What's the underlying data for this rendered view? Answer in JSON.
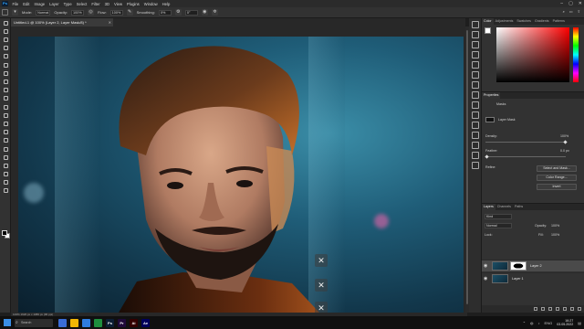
{
  "menubar": {
    "app_icon": "Ps",
    "items": [
      "File",
      "Edit",
      "Image",
      "Layer",
      "Type",
      "Select",
      "Filter",
      "3D",
      "View",
      "Plugins",
      "Window",
      "Help"
    ],
    "window_controls": [
      "minimize-icon",
      "maximize-icon",
      "close-icon"
    ]
  },
  "options": {
    "mode_label": "Mode:",
    "mode_value": "Normal",
    "opacity_label": "Opacity:",
    "opacity_value": "100%",
    "flow_label": "Flow:",
    "flow_value": "100%",
    "smoothing_label": "Smoothing:",
    "smoothing_value": "0%",
    "angle_value": "0°"
  },
  "document": {
    "tab_title": "Untitled-1 @ 100% (Layer 2, Layer Mask/8) *",
    "status": "100%   1920 px x 1080 px (96 ppi)"
  },
  "overlay_buttons": [
    "close-icon",
    "close-icon",
    "close-icon"
  ],
  "panels": {
    "color_tabs": [
      "Color",
      "Adjustments",
      "Swatches",
      "Gradients",
      "Patterns"
    ],
    "properties": {
      "title": "Properties",
      "section": "Masks",
      "mask_label": "Layer Mask",
      "density_label": "Density:",
      "density_value": "100%",
      "feather_label": "Feather:",
      "feather_value": "0.0 px",
      "refine_label": "Refine:",
      "buttons": [
        "Select and Mask...",
        "Color Range...",
        "Invert"
      ]
    },
    "layers": {
      "tabs": [
        "Layers",
        "Channels",
        "Paths"
      ],
      "kind_label": "Kind",
      "blend_mode": "Normal",
      "opacity_label": "Opacity:",
      "opacity_value": "100%",
      "lock_label": "Lock:",
      "fill_label": "Fill:",
      "fill_value": "100%",
      "items": [
        {
          "name": "Layer 2",
          "active": true
        },
        {
          "name": "Layer 1",
          "active": false
        }
      ]
    }
  },
  "taskbar": {
    "search_placeholder": "Search",
    "apps": [
      {
        "label": "",
        "color": "#3a6cd6"
      },
      {
        "label": "",
        "color": "#f2b705"
      },
      {
        "label": "",
        "color": "#2f7de1"
      },
      {
        "label": "",
        "color": "#1e8e3e"
      },
      {
        "label": "Ps",
        "color": "#0c1e34"
      },
      {
        "label": "Pr",
        "color": "#1f0a3a"
      },
      {
        "label": "Ai",
        "color": "#330000"
      },
      {
        "label": "Ae",
        "color": "#00005b"
      }
    ],
    "language": "ENG",
    "time": "16:27",
    "date": "03.05.2022"
  }
}
